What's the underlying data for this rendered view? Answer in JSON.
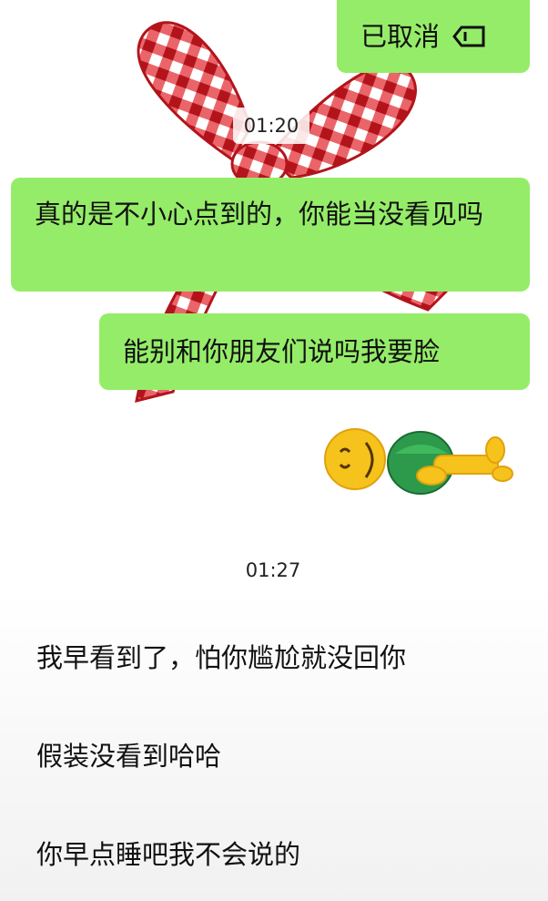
{
  "messages": {
    "recalled_label": "已取消",
    "time1": "01:20",
    "sent1": "真的是不小心点到的，你能当没看见吗",
    "sent2": "能别和你朋友们说吗我要脸",
    "time2": "01:27",
    "reply1": "我早看到了，怕你尴尬就没回你",
    "reply2": "假装没看到哈哈",
    "reply3": "你早点睡吧我不会说的"
  },
  "icons": {
    "recalled_icon": "tag-icon",
    "sticker_face": "smirk-face-icon",
    "sticker_body": "lying-figure-icon"
  },
  "colors": {
    "bubble_green": "#95ec69",
    "bow_red": "#d9232a"
  }
}
